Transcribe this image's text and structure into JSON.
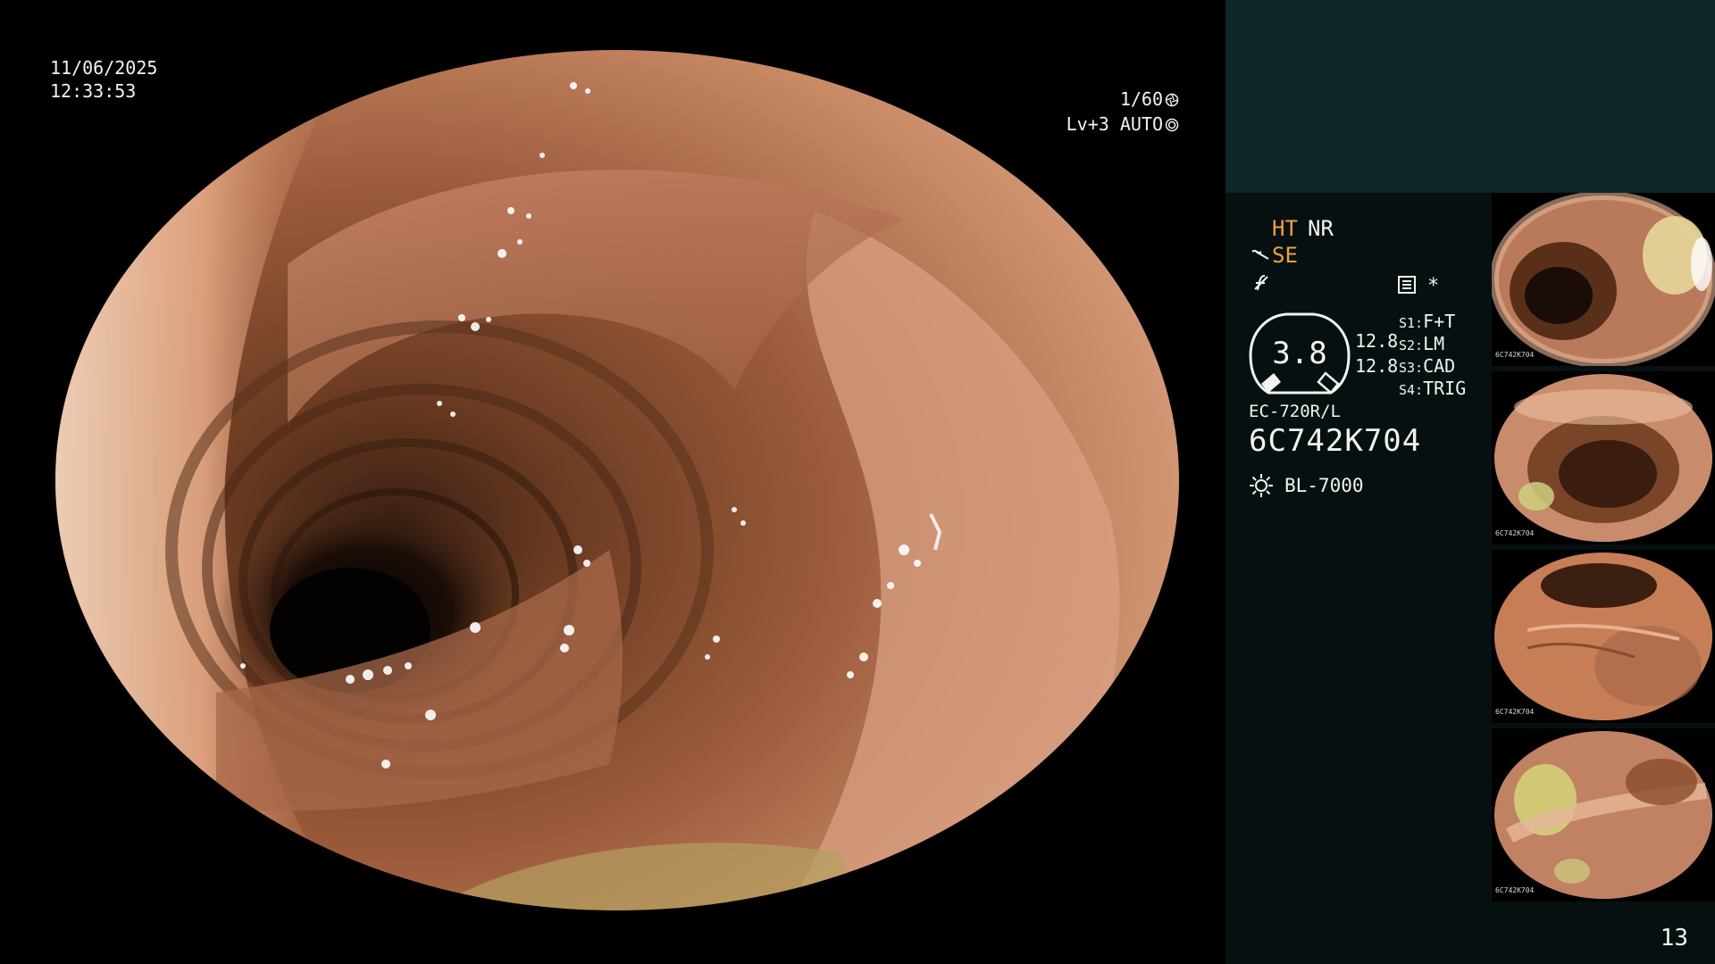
{
  "osd": {
    "date": "11/06/2025",
    "time": "12:33:53",
    "shutter": "1/60",
    "level": "Lv+3 AUTO"
  },
  "panel": {
    "mode_ht": "HT",
    "mode_nr": "NR",
    "mode_se": "SE",
    "asterisk": "*",
    "zoom_value": "3.8",
    "magnification_1": "12.8",
    "magnification_2": "12.8",
    "switches": [
      {
        "key": "S1:",
        "value": "F+T"
      },
      {
        "key": "S2:",
        "value": "LM"
      },
      {
        "key": "S3:",
        "value": "CAD"
      },
      {
        "key": "S4:",
        "value": "TRIG"
      }
    ],
    "scope_model": "EC-720R/L",
    "scope_serial": "6C742K704",
    "light_source": "BL-7000"
  },
  "thumbnails": [
    {
      "caption": "6C742K704"
    },
    {
      "caption": "6C742K704"
    },
    {
      "caption": "6C742K704"
    },
    {
      "caption": "6C742K704"
    }
  ],
  "page_number": "13",
  "colors": {
    "panel_background": "#071010",
    "panel_header": "#0d2626",
    "accent_orange": "#f0a040",
    "text": "#f2f2f2"
  },
  "icons": {
    "shutter": "aperture-icon",
    "auto_level": "target-icon",
    "structure_enhancement": "se-wave-icon",
    "filter": "f-slash-icon",
    "memo": "memo-icon",
    "light_source": "sun-icon"
  }
}
